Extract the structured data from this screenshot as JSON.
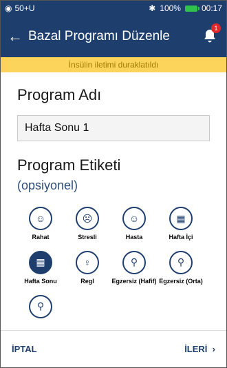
{
  "status": {
    "carrier": "50+U",
    "battery": "100%",
    "time": "00:17"
  },
  "header": {
    "title": "Bazal Programı Düzenle",
    "notification_count": "1"
  },
  "banner": "İnsülin iletimi duraklatıldı",
  "program_name": {
    "label": "Program Adı",
    "value": "Hafta Sonu 1"
  },
  "program_tag": {
    "label": "Program Etiketi",
    "optional": "(opsiyonel)"
  },
  "tags": [
    {
      "label": "Rahat",
      "icon": "smile-icon"
    },
    {
      "label": "Stresli",
      "icon": "stressed-face-icon"
    },
    {
      "label": "Hasta",
      "icon": "sick-face-icon"
    },
    {
      "label": "Hafta İçi",
      "icon": "calendar-icon"
    },
    {
      "label": "Hafta Sonu",
      "icon": "calendar-icon"
    },
    {
      "label": "Regl",
      "icon": "person-icon"
    },
    {
      "label": "Egzersiz (Hafif)",
      "icon": "exercise-icon"
    },
    {
      "label": "Egzersiz (Orta)",
      "icon": "exercise-icon"
    },
    {
      "label": "",
      "icon": "exercise-icon"
    }
  ],
  "footer": {
    "cancel": "İPTAL",
    "next": "İLERİ"
  }
}
